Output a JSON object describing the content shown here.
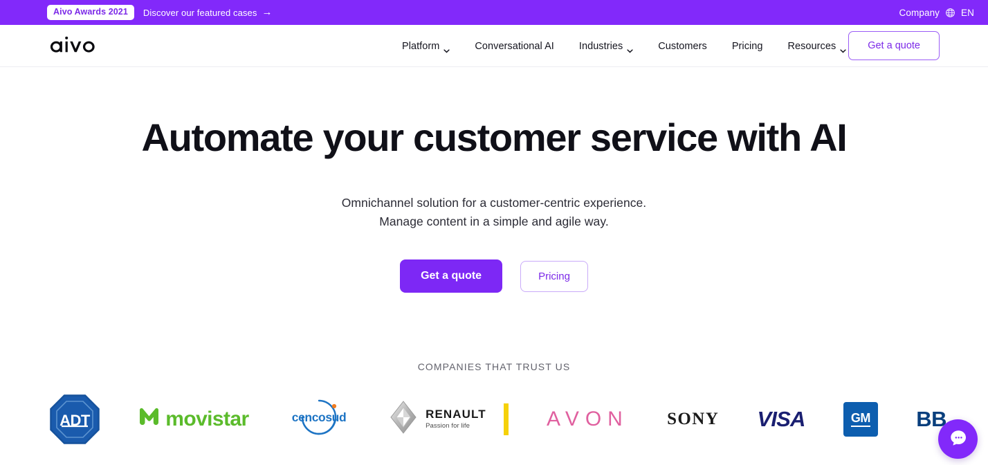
{
  "announcement": {
    "badge": "Aivo Awards 2021",
    "link_text": "Discover our featured cases",
    "arrow": "→",
    "company_label": "Company",
    "globe_icon": "globe-icon",
    "language": "EN",
    "background_color": "#8229fa"
  },
  "header": {
    "logo_text": "aivo",
    "nav": [
      {
        "label": "Platform",
        "has_dropdown": true
      },
      {
        "label": "Conversational AI",
        "has_dropdown": false
      },
      {
        "label": "Industries",
        "has_dropdown": true
      },
      {
        "label": "Customers",
        "has_dropdown": false
      },
      {
        "label": "Pricing",
        "has_dropdown": false
      },
      {
        "label": "Resources",
        "has_dropdown": true
      }
    ],
    "cta_label": "Get a quote",
    "accent_color": "#7c2ae8"
  },
  "hero": {
    "title": "Automate your customer service with AI",
    "subtitle_line1": "Omnichannel solution for a customer-centric experience.",
    "subtitle_line2": "Manage content in a simple and agile way.",
    "primary_button": "Get a quote",
    "secondary_button": "Pricing",
    "primary_color": "#7d28f5"
  },
  "trust": {
    "label": "COMPANIES THAT TRUST US",
    "logos": [
      {
        "name": "ADT",
        "text": "ADT",
        "color": "#1a5bad"
      },
      {
        "name": "Movistar",
        "text": "movistar",
        "color": "#5bbb2b"
      },
      {
        "name": "Cencosud",
        "text": "cencosud",
        "color": "#1d74c4"
      },
      {
        "name": "Renault",
        "text": "RENAULT",
        "tagline": "Passion for life",
        "color": "#f5d10a"
      },
      {
        "name": "Avon",
        "text": "AVON",
        "color": "#e0609f"
      },
      {
        "name": "Sony",
        "text": "SONY",
        "color": "#1b1b1b"
      },
      {
        "name": "Visa",
        "text": "VISA",
        "color": "#1a1f71"
      },
      {
        "name": "GM",
        "text": "GM",
        "color": "#0d5eaf"
      },
      {
        "name": "BBVA",
        "text": "BB",
        "color": "#093f7d"
      }
    ]
  },
  "chat": {
    "icon": "chat-bubble-icon",
    "color": "#8229fa"
  }
}
